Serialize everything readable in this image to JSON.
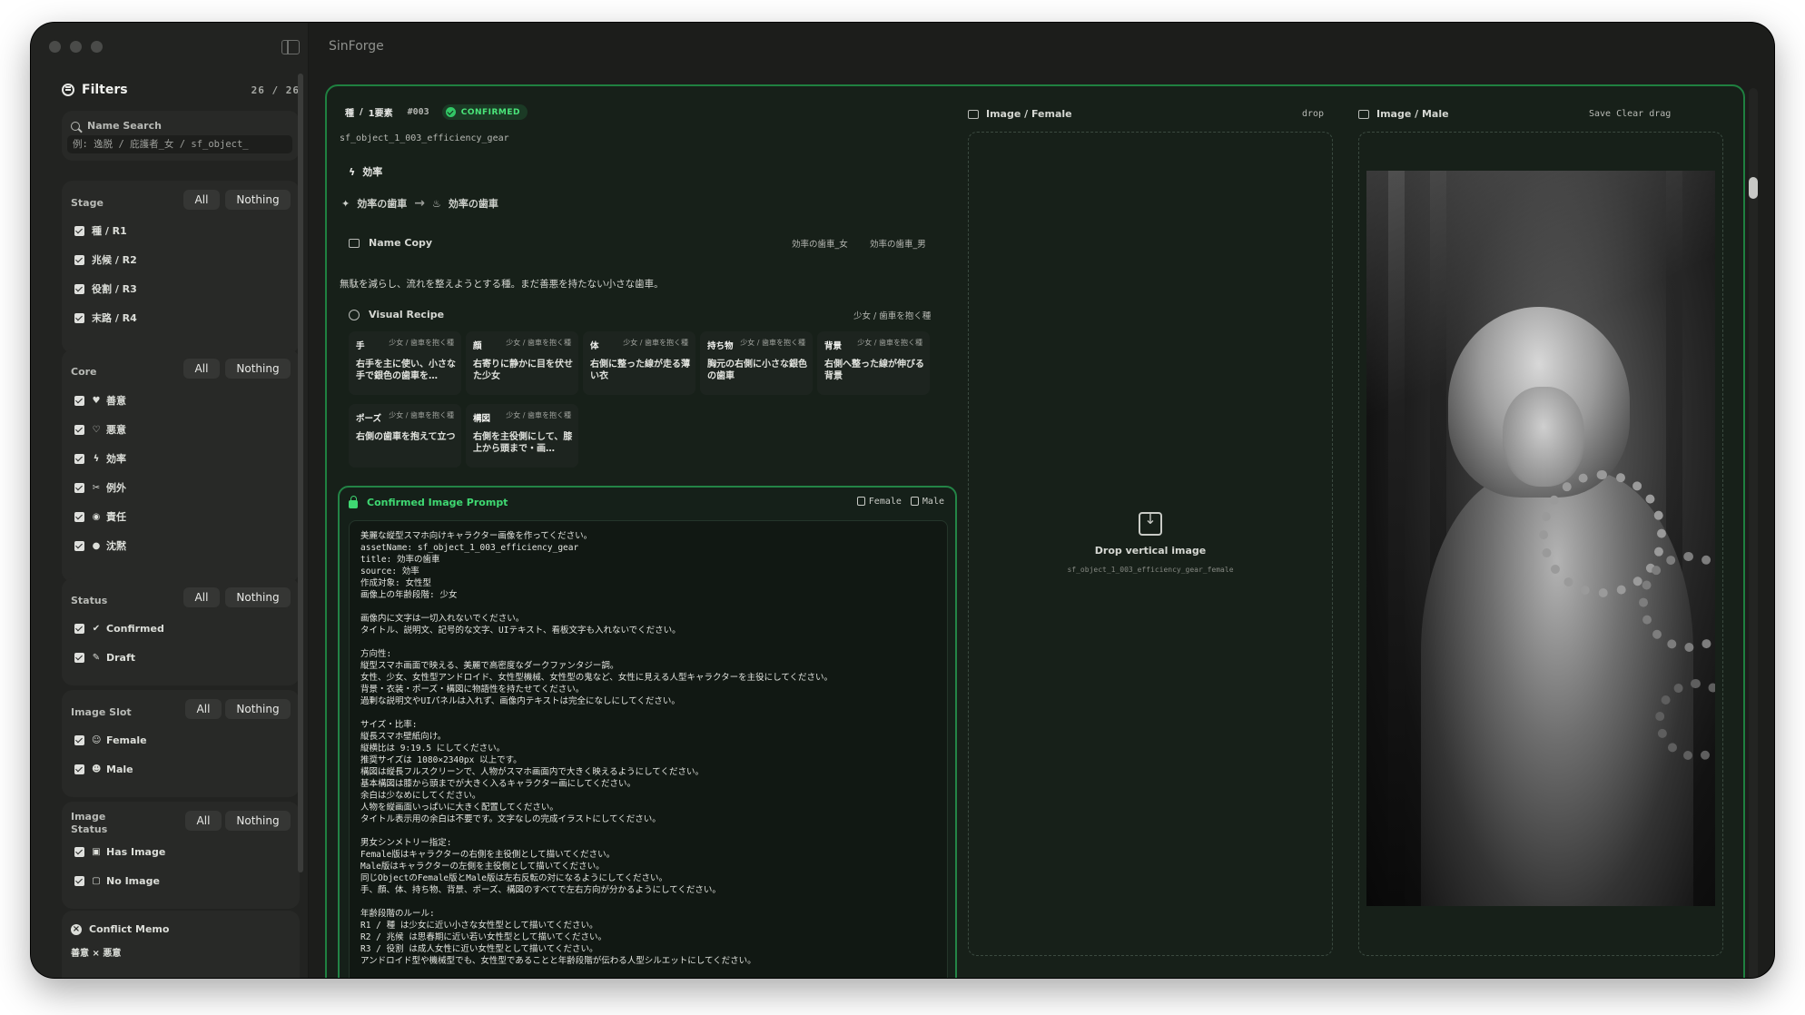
{
  "app": {
    "title": "SinForge"
  },
  "sidebar": {
    "filters_title": "Filters",
    "filters_count": "26 / 26",
    "search": {
      "label": "Name Search",
      "placeholder": "例: 逸脱 / 庇護者_女 / sf_object_"
    },
    "all_label": "All",
    "nothing_label": "Nothing",
    "groups": [
      {
        "name": "Stage",
        "options": [
          "種 / R1",
          "兆候 / R2",
          "役割 / R3",
          "末路 / R4"
        ]
      },
      {
        "name": "Core",
        "options": [
          "善意",
          "悪意",
          "効率",
          "例外",
          "責任",
          "沈黙"
        ]
      },
      {
        "name": "Status",
        "options": [
          "Confirmed",
          "Draft"
        ]
      },
      {
        "name": "Image Slot",
        "options": [
          "Female",
          "Male"
        ]
      },
      {
        "name": "Image Status",
        "options": [
          "Has Image",
          "No Image"
        ]
      }
    ],
    "conflict": {
      "title": "Conflict Memo",
      "pair": "善意 × 悪意"
    }
  },
  "detail": {
    "breadcrumb_stage": "種",
    "breadcrumb_sep": "/",
    "breadcrumb_elements": "1要素",
    "number": "#003",
    "status_badge": "CONFIRMED",
    "asset_name": "sf_object_1_003_efficiency_gear",
    "core": "効率",
    "title_female": "効率の歯車",
    "title_male": "効率の歯車",
    "name_copy_label": "Name Copy",
    "name_copy_female": "効率の歯車_女",
    "name_copy_male": "効率の歯車_男",
    "description": "無駄を減らし、流れを整えようとする種。まだ善悪を持たない小さな歯車。",
    "visual_recipe_label": "Visual Recipe",
    "visual_recipe_tag": "少女 / 歯車を抱く種",
    "recipe": [
      {
        "key": "手",
        "sub": "少女 / 歯車を抱く種",
        "value": "右手を主に使い、小さな手で銀色の歯車を…"
      },
      {
        "key": "顔",
        "sub": "少女 / 歯車を抱く種",
        "value": "右寄りに静かに目を伏せた少女"
      },
      {
        "key": "体",
        "sub": "少女 / 歯車を抱く種",
        "value": "右側に整った線が走る薄い衣"
      },
      {
        "key": "持ち物",
        "sub": "少女 / 歯車を抱く種",
        "value": "胸元の右側に小さな銀色の歯車"
      },
      {
        "key": "背景",
        "sub": "少女 / 歯車を抱く種",
        "value": "右側へ整った線が伸びる背景"
      },
      {
        "key": "ポーズ",
        "sub": "少女 / 歯車を抱く種",
        "value": "右側の歯車を抱えて立つ"
      },
      {
        "key": "構図",
        "sub": "少女 / 歯車を抱く種",
        "value": "右側を主役側にして、膝上から頭まで・画…"
      }
    ],
    "prompt": {
      "title": "Confirmed Image Prompt",
      "copy_female": "Female",
      "copy_male": "Male",
      "text": "美麗な縦型スマホ向けキャラクター画像を作ってください。\nassetName: sf_object_1_003_efficiency_gear\ntitle: 効率の歯車\nsource: 効率\n作成対象: 女性型\n画像上の年齢段階: 少女\n\n画像内に文字は一切入れないでください。\nタイトル、説明文、記号的な文字、UIテキスト、看板文字も入れないでください。\n\n方向性:\n縦型スマホ画面で映える、美麗で高密度なダークファンタジー調。\n女性、少女、女性型アンドロイド、女性型機械、女性型の鬼など、女性に見える人型キャラクターを主役にしてください。\n背景・衣装・ポーズ・構図に物語性を持たせてください。\n過剰な説明文やUIパネルは入れず、画像内テキストは完全になしにしてください。\n\nサイズ・比率:\n縦長スマホ壁紙向け。\n縦横比は 9:19.5 にしてください。\n推奨サイズは 1080×2340px 以上です。\n構図は縦長フルスクリーンで、人物がスマホ画面内で大きく映えるようにしてください。\n基本構図は膝から頭までが大きく入るキャラクター画にしてください。\n余白は少なめにしてください。\n人物を縦画面いっぱいに大きく配置してください。\nタイトル表示用の余白は不要です。文字なしの完成イラストにしてください。\n\n男女シンメトリー指定:\nFemale版はキャラクターの右側を主役側として描いてください。\nMale版はキャラクターの左側を主役側として描いてください。\n同じObjectのFemale版とMale版は左右反転の対になるようにしてください。\n手、顔、体、持ち物、背景、ポーズ、構図のすべてで左右方向が分かるようにしてください。\n\n年齢段階のルール:\nR1 / 種 は少女に近い小さな女性型として描いてください。\nR2 / 兆候 は思春期に近い若い女性型として描いてください。\nR3 / 役割 は成人女性に近い女性型として描いてください。\nアンドロイド型や機械型でも、女性型であることと年齢段階が伝わる人型シルエットにしてください。"
    },
    "image_female": {
      "label": "Image / Female",
      "action": "drop",
      "drop_title": "Drop vertical image",
      "drop_file": "sf_object_1_003_efficiency_gear_female"
    },
    "image_male": {
      "label": "Image / Male",
      "actions": "Save Clear drag"
    }
  }
}
